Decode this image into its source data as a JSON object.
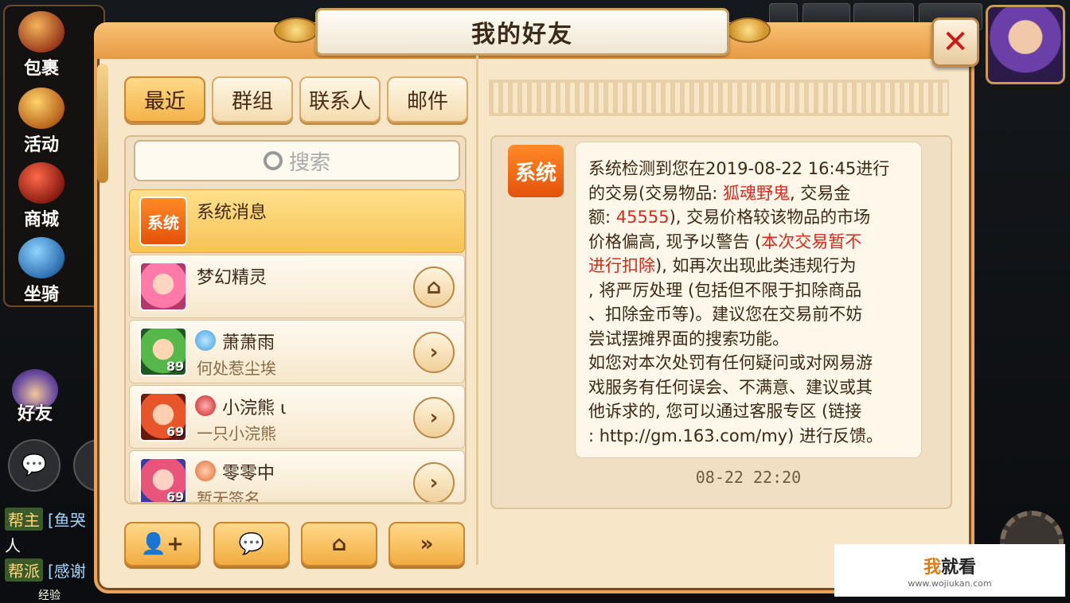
{
  "left_sidebar": {
    "items": [
      {
        "label": "包裹",
        "icon": "bag-icon"
      },
      {
        "label": "活动",
        "icon": "horn-icon"
      },
      {
        "label": "商城",
        "icon": "shop-icon"
      },
      {
        "label": "坐骑",
        "icon": "mount-icon"
      }
    ],
    "friends_label": "好友"
  },
  "chat": {
    "lines": [
      {
        "tag": "帮主",
        "text": "[鱼哭"
      },
      {
        "tag": "",
        "text": "人"
      },
      {
        "tag": "帮派",
        "text": "[感谢"
      }
    ],
    "exp_label": "经验"
  },
  "dialog": {
    "title": "我的好友",
    "close_label": "✕",
    "tabs": [
      "最近",
      "群组",
      "联系人",
      "邮件"
    ],
    "active_tab": "最近",
    "search_placeholder": "搜索",
    "contacts": [
      {
        "name": "系统消息",
        "sub": "",
        "badge": "系统",
        "level": "",
        "action": "",
        "selected": true
      },
      {
        "name": "梦幻精灵",
        "sub": "",
        "badge": "",
        "level": "",
        "action": "home-icon",
        "selected": false
      },
      {
        "name": "萧萧雨",
        "sub": "何处惹尘埃",
        "badge": "",
        "level": "89",
        "action": "chevron-right-icon",
        "selected": false
      },
      {
        "name": "小浣熊 ι",
        "sub": "一只小浣熊",
        "badge": "",
        "level": "69",
        "action": "chevron-right-icon",
        "selected": false
      },
      {
        "name": "零零中",
        "sub": "暂无签名",
        "badge": "",
        "level": "69",
        "action": "chevron-right-icon",
        "selected": false
      }
    ],
    "bottom_buttons": [
      {
        "name": "add-friend-button",
        "icon": "add-user-icon"
      },
      {
        "name": "chat-button",
        "icon": "chat-bubble-icon"
      },
      {
        "name": "home-button",
        "icon": "home-icon"
      },
      {
        "name": "more-button",
        "icon": "double-chevron-icon"
      }
    ],
    "message": {
      "sender_badge": "系统",
      "line1": "系统检测到您在2019-08-22 16:45进行",
      "line2_a": "的交易(交易物品: ",
      "item": "狐魂野鬼",
      "line2_b": ", 交易金",
      "line3_a": "额: ",
      "amount": "45555",
      "line3_b": "), 交易价格较该物品的市场",
      "line4_a": "价格偏高, 现予以警告 (",
      "warn1": "本次交易暂不",
      "warn2": "进行扣除",
      "line5_b": "), 如再次出现此类违规行为",
      "line6": ", 将严厉处理 (包括但不限于扣除商品",
      "line7": "、扣除金币等)。建议您在交易前不妨",
      "line8": "尝试摆摊界面的搜索功能。",
      "line9": "如您对本次处罚有任何疑问或对网易游",
      "line10": "戏服务有任何误会、不满意、建议或其",
      "line11": "他诉求的, 您可以通过客服专区 (链接",
      "line12": ": http://gm.163.com/my) 进行反馈。",
      "time": "08-22 22:20"
    }
  },
  "watermark": {
    "brand_a": "我",
    "brand_b": "就看",
    "url": "www.wojiukan.com"
  },
  "colors": {
    "accent": "#f3b449",
    "panel": "#f7e6c8",
    "warning_red": "#d62a1d",
    "system_orange": "#e4520a"
  }
}
